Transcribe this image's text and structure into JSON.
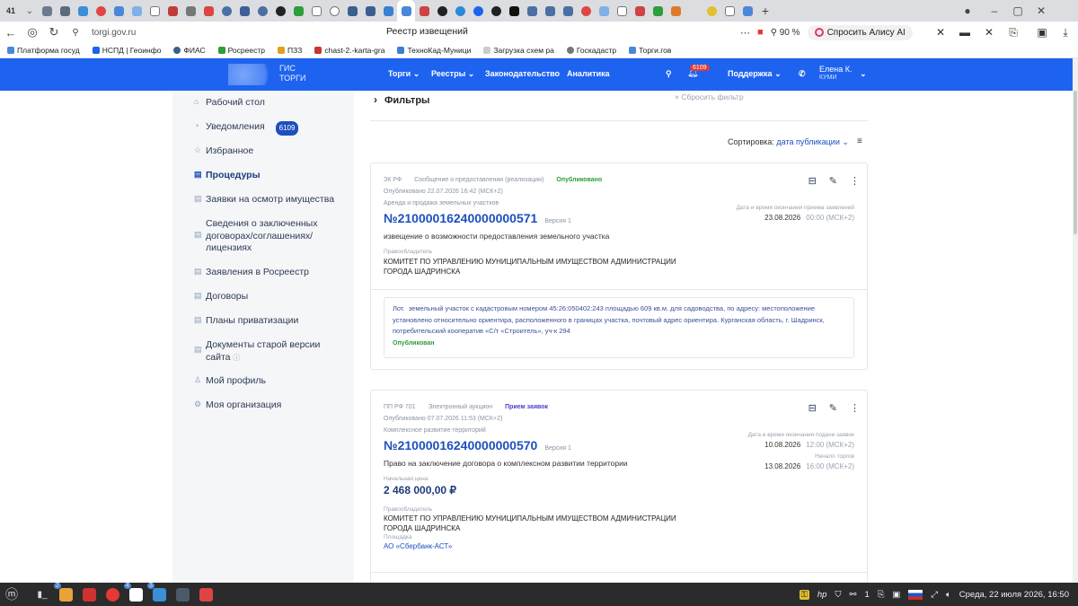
{
  "browser": {
    "tab_count": "41",
    "page_title": "Реестр извещений",
    "url": "torgi.gov.ru",
    "zoom": "90 %",
    "alice_label": "Спросить Алису AI",
    "bookmarks": [
      "Платформа госуд",
      "НСПД | Геоинфо",
      "ФИАС",
      "Росреестр",
      "ПЗЗ",
      "chast-2.-karta-gra",
      "ТехноКад-Муници",
      "Загрузка схем ра",
      "Госкадастр",
      "Торги.гов"
    ]
  },
  "header": {
    "logo_line1": "ГИС",
    "logo_line2": "ТОРГИ",
    "nav": [
      "Торги",
      "Реестры",
      "Законодательство",
      "Аналитика"
    ],
    "notif_badge": "6109",
    "support": "Поддержка",
    "user_name": "Елена К.",
    "user_org": "КУМИ"
  },
  "sidebar": {
    "items": [
      {
        "label": "Рабочий стол"
      },
      {
        "label": "Уведомления",
        "badge": "6109"
      },
      {
        "label": "Избранное"
      },
      {
        "label": "Процедуры"
      },
      {
        "label": "Заявки на осмотр имущества"
      },
      {
        "label": "Сведения о заключенных договорах/соглашениях/лицензиях"
      },
      {
        "label": "Заявления в Росреестр"
      },
      {
        "label": "Договоры"
      },
      {
        "label": "Планы приватизации"
      },
      {
        "label": "Документы старой версии сайта"
      },
      {
        "label": "Мой профиль"
      },
      {
        "label": "Моя организация"
      }
    ]
  },
  "filters": {
    "title": "Фильтры",
    "reset": "Сбросить фильтр"
  },
  "sort": {
    "label": "Сортировка:",
    "value": "дата публикации"
  },
  "cards": [
    {
      "law": "ЗК РФ",
      "type": "Сообщение о предоставлении (реализации)",
      "status": "Опубликовано",
      "published": "Опубликовано 22.07.2026 16:42 (МСК+2)",
      "category": "Аренда и продажа земельных участков",
      "number": "№21000016240000000571",
      "version": "Версия 1",
      "title": "извещение о возможности предоставления земельного участка",
      "holder_label": "Правообладатель",
      "holder": "КОМИТЕТ ПО УПРАВЛЕНИЮ МУНИЦИПАЛЬНЫМ ИМУЩЕСТВОМ АДМИНИСТРАЦИИ ГОРОДА ШАДРИНСКА",
      "date_label": "Дата и время окончания приема заявлений",
      "date": "23.08.2026",
      "time": "00:00 (МСК+2)",
      "lot_prefix": "Лот.",
      "lot_text": "земельный участок с кадастровым номером 45:26:050402:243 площадью 609 кв.м. для садоводства, по адресу: местоположение установлено относительно ориентира, расположенного в границах участка, почтовый адрес ориентира. Курганская область, г. Шадринск, потребительский кооператив «С/т «Строитель», уч-к 294",
      "lot_status": "Опубликован"
    },
    {
      "law": "ПП РФ 701",
      "type": "Электронный аукцион",
      "status": "Прием заявок",
      "published": "Опубликовано 07.07.2026 11:53 (МСК+2)",
      "category": "Комплексное развитие территорий",
      "number": "№21000016240000000570",
      "version": "Версия 1",
      "title": "Право на заключение договора о комплексном развитии территории",
      "price_label": "Начальная цена",
      "price": "2 468 000,00 ₽",
      "holder_label": "Правообладатель",
      "holder": "КОМИТЕТ ПО УПРАВЛЕНИЮ МУНИЦИПАЛЬНЫМ ИМУЩЕСТВОМ АДМИНИСТРАЦИИ ГОРОДА ШАДРИНСКА",
      "platform_label": "Площадка",
      "platform": "АО «Сбербанк-АСТ»",
      "date_label": "Дата и время окончания подачи заявок",
      "date": "10.08.2026",
      "time": "12:00 (МСК+2)",
      "start_label": "Начало торгов",
      "start_date": "13.08.2026",
      "start_time": "16:00 (МСК+2)"
    }
  ],
  "taskbar": {
    "datetime": "Среда, 22 июля 2026, 16:50",
    "badges": [
      "2",
      "4",
      "3"
    ],
    "tray_num": "1"
  },
  "colors": {
    "brand": "#1d63f0",
    "link": "#1d4fbf",
    "published": "#2e9d3c"
  }
}
